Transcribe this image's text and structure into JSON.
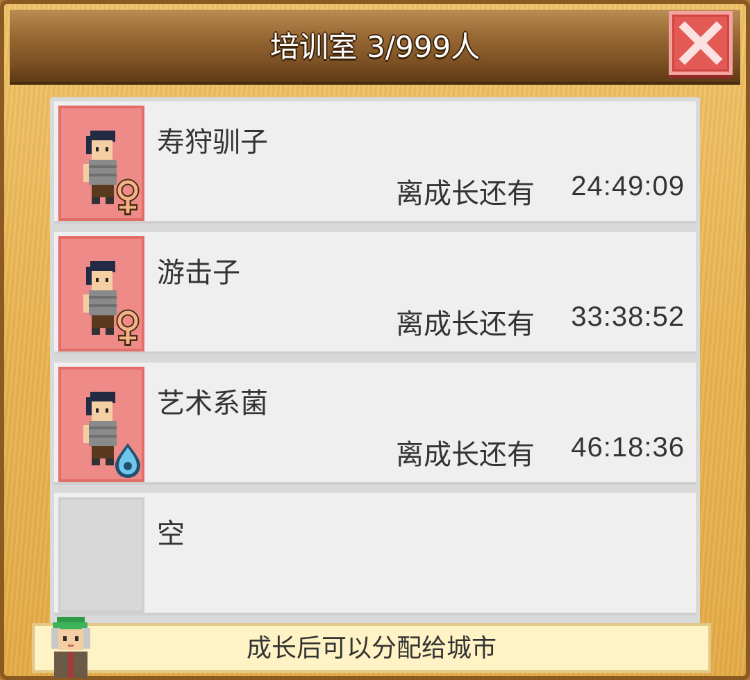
{
  "window": {
    "title": "培训室 3/999人"
  },
  "trainees": [
    {
      "name": "寿狩驯子",
      "status_label": "离成长还有",
      "time_remaining": "24:49:09",
      "gender_icon": "female-icon"
    },
    {
      "name": "游击子",
      "status_label": "离成长还有",
      "time_remaining": "33:38:52",
      "gender_icon": "female-icon"
    },
    {
      "name": "艺术系菌",
      "status_label": "离成长还有",
      "time_remaining": "46:18:36",
      "gender_icon": "water-drop-icon"
    }
  ],
  "empty_slot": {
    "label": "空"
  },
  "footer": {
    "hint": "成长后可以分配给城市"
  },
  "colors": {
    "panel_wood": "#eab552",
    "title_bar": "#7a4f22",
    "close_button": "#e35a55",
    "avatar_bg": "#ee8b88",
    "row_bg": "#efefef",
    "footer_bg": "#fff2c4"
  }
}
